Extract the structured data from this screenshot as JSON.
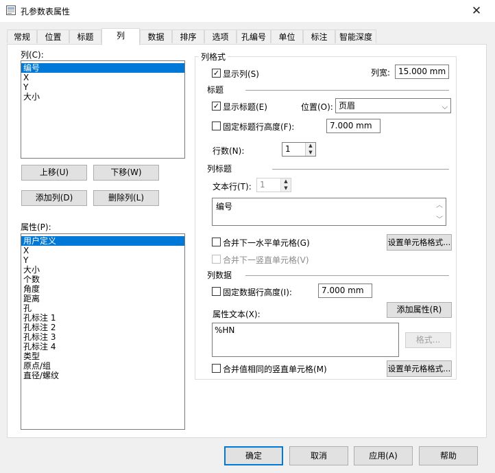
{
  "window": {
    "title": "孔参数表属性",
    "close_label": "✕"
  },
  "tabs": [
    "常规",
    "位置",
    "标题",
    "列",
    "数据",
    "排序",
    "选项",
    "孔编号",
    "单位",
    "标注",
    "智能深度"
  ],
  "columns": {
    "label": "列(C):",
    "items": [
      "编号",
      "X",
      "Y",
      "大小"
    ],
    "selected": 0
  },
  "buttons": {
    "move_up": "上移(U)",
    "move_down": "下移(W)",
    "add_column": "添加列(D)",
    "delete_column": "删除列(L)"
  },
  "attributes": {
    "label": "属性(P):",
    "items": [
      "用户定义",
      "X",
      "Y",
      "大小",
      "个数",
      "角度",
      "距离",
      "孔",
      "孔标注 1",
      "孔标注 2",
      "孔标注 3",
      "孔标注 4",
      "类型",
      "原点/组",
      "直径/螺纹"
    ],
    "selected": 0
  },
  "format": {
    "group_title": "列格式",
    "show_column": {
      "label": "显示列(S)",
      "checked": true
    },
    "width_label": "列宽:",
    "width_value": "15.000 mm",
    "title_section": "标题",
    "show_title": {
      "label": "显示标题(E)",
      "checked": true
    },
    "position_label": "位置(O):",
    "position_value": "页眉",
    "fixed_title_height": {
      "label": "固定标题行高度(F):",
      "checked": false
    },
    "title_height_value": "7.000 mm",
    "rows_label": "行数(N):",
    "rows_value": "1",
    "column_title_section": "列标题",
    "text_row_label": "文本行(T):",
    "text_row_value": "1",
    "column_title_text": "编号",
    "merge_horizontal": {
      "label": "合并下一水平单元格(G)",
      "checked": false
    },
    "set_cell_format_1": "设置单元格格式...",
    "merge_vertical": {
      "label": "合并下一竖直单元格(V)",
      "checked": false
    },
    "column_data_section": "列数据",
    "fixed_data_height": {
      "label": "固定数据行高度(I):",
      "checked": false
    },
    "data_height_value": "7.000 mm",
    "attribute_text_label": "属性文本(X):",
    "add_attribute": "添加属性(R)",
    "attribute_text_value": "%HN",
    "format_button": "格式...",
    "merge_same_vertical": {
      "label": "合并值相同的竖直单元格(M)",
      "checked": false
    },
    "set_cell_format_2": "设置单元格格式..."
  },
  "footer": {
    "ok": "确定",
    "cancel": "取消",
    "apply": "应用(A)",
    "help": "帮助"
  },
  "icons": {
    "check": "✓",
    "spin_up": "▲",
    "spin_down": "▼",
    "dropdown": "⌵",
    "scroll_up": "︿",
    "scroll_down": "﹀"
  }
}
